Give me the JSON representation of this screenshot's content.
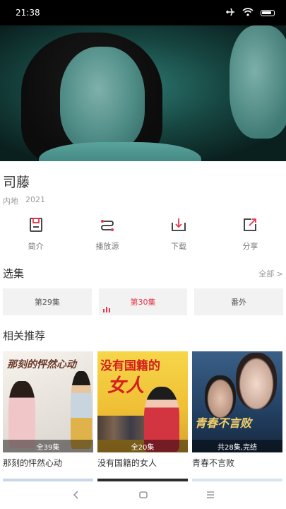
{
  "status_bar": {
    "time": "21:38",
    "icons": [
      "airplane-icon",
      "wifi-icon",
      "battery-icon"
    ]
  },
  "video": {
    "description": "player-frame"
  },
  "show": {
    "title": "司藤",
    "region": "内地",
    "year": "2021"
  },
  "actions": [
    {
      "label": "简介",
      "icon": "intro-icon"
    },
    {
      "label": "播放源",
      "icon": "source-icon"
    },
    {
      "label": "下载",
      "icon": "download-icon"
    },
    {
      "label": "分享",
      "icon": "share-icon"
    }
  ],
  "episodes_section": {
    "title": "选集",
    "more": "全部 >"
  },
  "episodes": [
    {
      "label": "第29集",
      "active": false
    },
    {
      "label": "第30集",
      "active": true
    },
    {
      "label": "番外",
      "active": false
    }
  ],
  "recommend_section": {
    "title": "相关推荐"
  },
  "recommendations": [
    {
      "title": "那刻的怦然心动",
      "badge": "全39集",
      "poster_text": "那刻的怦然心动"
    },
    {
      "title": "没有国籍的女人",
      "badge": "全20集",
      "poster_text": "没有国籍的",
      "poster_text2": "女人"
    },
    {
      "title": "青春不言败",
      "badge": "共28集,完结",
      "poster_text": "青春不言败"
    }
  ],
  "colors": {
    "accent": "#e6364a",
    "status_bar": "#000000"
  }
}
